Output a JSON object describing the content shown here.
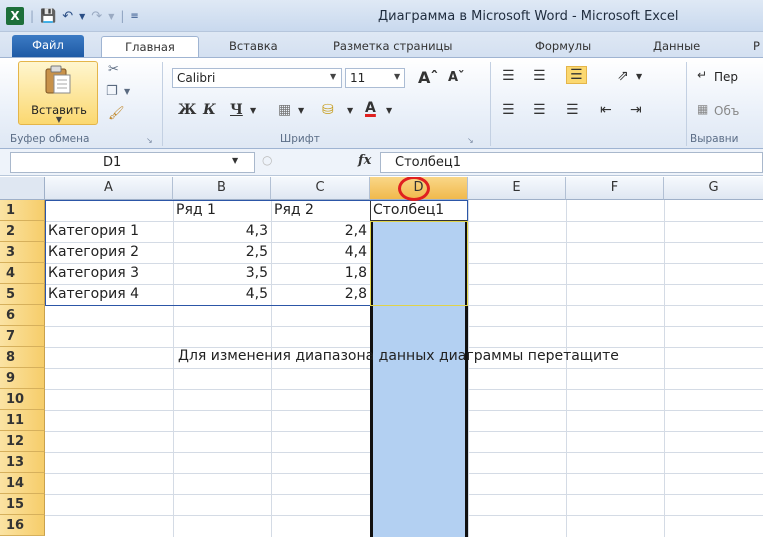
{
  "window": {
    "logo": "X",
    "title": "Диаграмма в Microsoft Word - Microsoft Excel"
  },
  "tabs": [
    {
      "label": "Файл"
    },
    {
      "label": "Главная"
    },
    {
      "label": "Вставка"
    },
    {
      "label": "Разметка страницы"
    },
    {
      "label": "Формулы"
    },
    {
      "label": "Данные"
    },
    {
      "label": "Р"
    }
  ],
  "ribbon": {
    "paste_label": "Вставить",
    "clipboard_group": "Буфер обмена",
    "font_name": "Calibri",
    "font_size": "11",
    "font_group": "Шрифт",
    "bold": "Ж",
    "italic": "К",
    "underline": "Ч",
    "wrap_label": "Пер",
    "merge_label": "Объ",
    "align_group": "Выравни"
  },
  "formula_bar": {
    "name_box": "D1",
    "fx": "fx",
    "value": "Столбец1"
  },
  "columns": [
    "A",
    "B",
    "C",
    "D",
    "E",
    "F",
    "G"
  ],
  "selected_column": "D",
  "rows": [
    "1",
    "2",
    "3",
    "4",
    "5",
    "6",
    "7",
    "8",
    "9",
    "10",
    "11",
    "12",
    "13",
    "14",
    "15",
    "16"
  ],
  "cells": {
    "B1": "Ряд 1",
    "C1": "Ряд 2",
    "D1": "Столбец1",
    "A2": "Категория 1",
    "B2": "4,3",
    "C2": "2,4",
    "A3": "Категория 2",
    "B3": "2,5",
    "C3": "4,4",
    "A4": "Категория 3",
    "B4": "3,5",
    "C4": "1,8",
    "A5": "Категория 4",
    "B5": "4,5",
    "C5": "2,8"
  },
  "note": "Для изменения диапазона данных диаграммы перетащите"
}
